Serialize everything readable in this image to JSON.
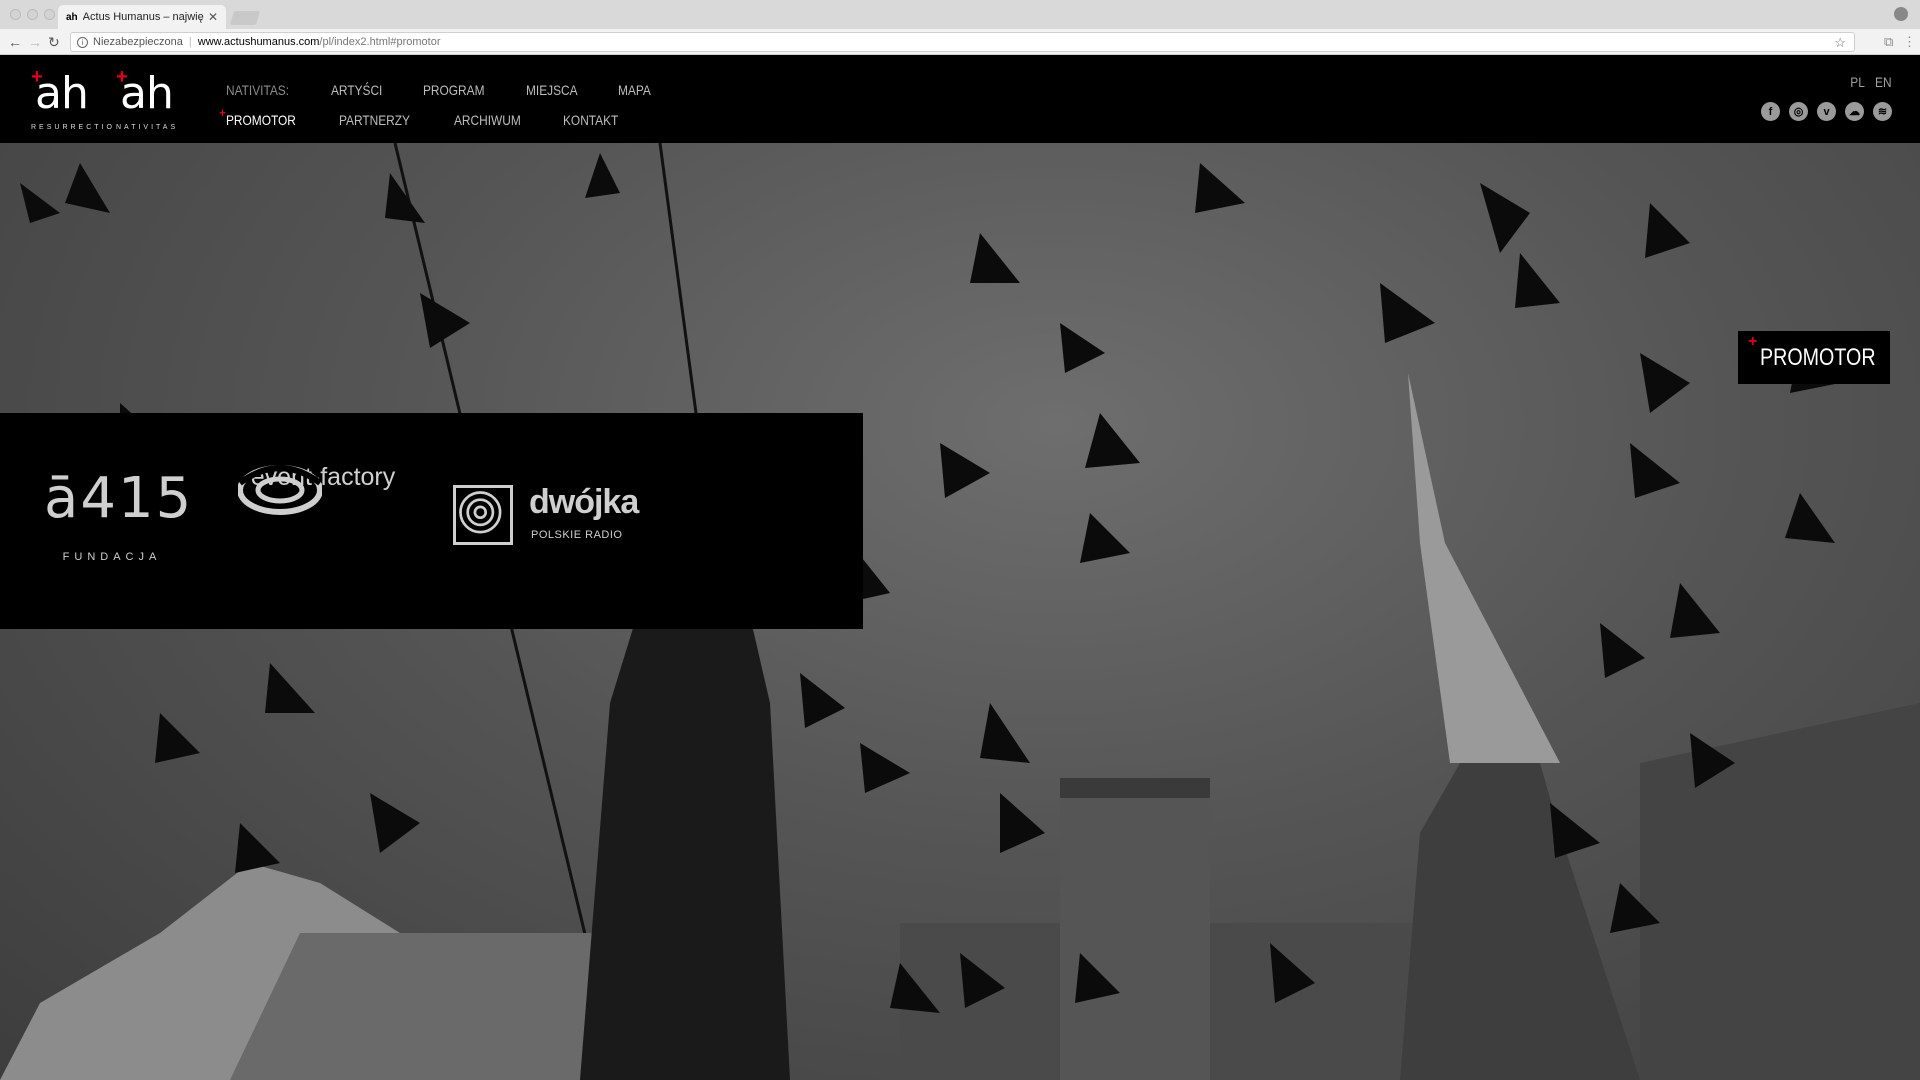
{
  "browser": {
    "tab_title": "Actus Humanus – największy p",
    "favicon": "ah",
    "address": {
      "security": "Niezabezpieczona",
      "host": "www.actushumanus.com",
      "path": "/pl/index2.html#promotor"
    }
  },
  "header": {
    "logos": [
      {
        "mark": "ah",
        "sub": "RESURRECTIO"
      },
      {
        "mark": "ah",
        "sub": "NATIVITAS"
      }
    ],
    "nav_row1": [
      "NATIVITAS:",
      "ARTYŚCI",
      "PROGRAM",
      "MIEJSCA",
      "MAPA"
    ],
    "nav_row2": [
      "PROMOTOR",
      "PARTNERZY",
      "ARCHIWUM",
      "KONTAKT"
    ],
    "languages": [
      "PL",
      "EN"
    ],
    "social_icons": [
      "facebook-icon",
      "instagram-icon",
      "vimeo-icon",
      "soundcloud-icon",
      "spotify-icon"
    ],
    "accent_color": "#e3001b"
  },
  "section": {
    "badge": "PROMOTOR",
    "partners": {
      "a415_mark": "ā415",
      "a415_label": "FUNDACJA",
      "event_factory": "event-factory",
      "dwojka": "dwójka",
      "dwojka_sub": "POLSKIE RADIO"
    }
  }
}
